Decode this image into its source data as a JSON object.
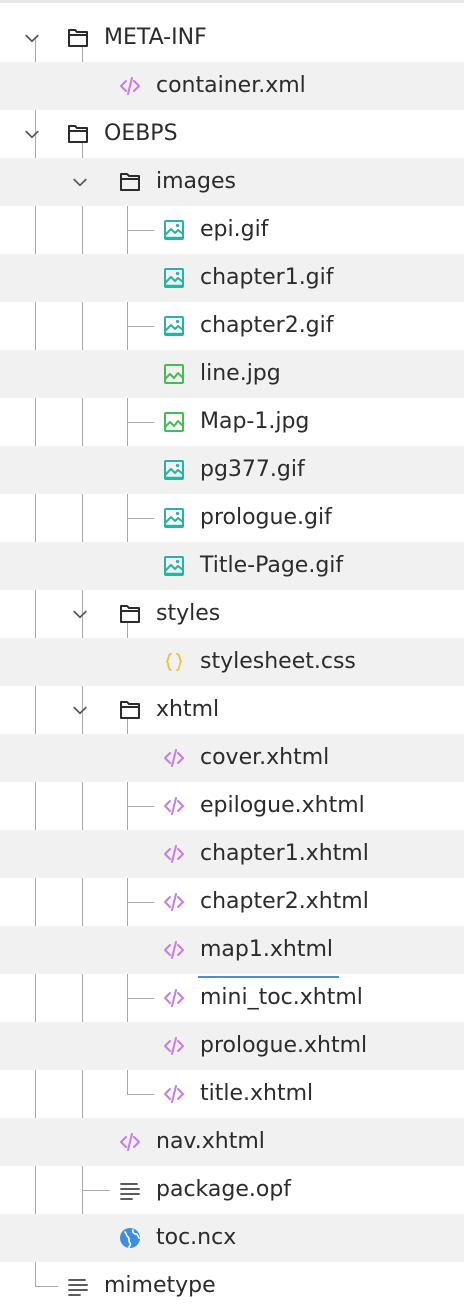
{
  "tree": {
    "nodes": [
      {
        "label": "META-INF",
        "type": "folder",
        "depth": 0,
        "expanded": true,
        "name": "folder-meta-inf"
      },
      {
        "label": "container.xml",
        "type": "xml",
        "depth": 1,
        "name": "file-container-xml"
      },
      {
        "label": "OEBPS",
        "type": "folder",
        "depth": 0,
        "expanded": true,
        "name": "folder-oebps"
      },
      {
        "label": "images",
        "type": "folder",
        "depth": 1,
        "expanded": true,
        "name": "folder-images"
      },
      {
        "label": "epi.gif",
        "type": "gif",
        "depth": 2,
        "name": "file-epi-gif"
      },
      {
        "label": "chapter1.gif",
        "type": "gif",
        "depth": 2,
        "name": "file-chapter1-gif"
      },
      {
        "label": "chapter2.gif",
        "type": "gif",
        "depth": 2,
        "name": "file-chapter2-gif"
      },
      {
        "label": "line.jpg",
        "type": "jpg",
        "depth": 2,
        "name": "file-line-jpg"
      },
      {
        "label": "Map-1.jpg",
        "type": "jpg",
        "depth": 2,
        "name": "file-map-1-jpg"
      },
      {
        "label": "pg377.gif",
        "type": "gif",
        "depth": 2,
        "name": "file-pg377-gif"
      },
      {
        "label": "prologue.gif",
        "type": "gif",
        "depth": 2,
        "name": "file-prologue-gif"
      },
      {
        "label": "Title-Page.gif",
        "type": "gif",
        "depth": 2,
        "name": "file-title-page-gif"
      },
      {
        "label": "styles",
        "type": "folder",
        "depth": 1,
        "expanded": true,
        "name": "folder-styles"
      },
      {
        "label": "stylesheet.css",
        "type": "css",
        "depth": 2,
        "name": "file-stylesheet-css"
      },
      {
        "label": "xhtml",
        "type": "folder",
        "depth": 1,
        "expanded": true,
        "name": "folder-xhtml"
      },
      {
        "label": "cover.xhtml",
        "type": "xml",
        "depth": 2,
        "name": "file-cover-xhtml"
      },
      {
        "label": "epilogue.xhtml",
        "type": "xml",
        "depth": 2,
        "name": "file-epilogue-xhtml"
      },
      {
        "label": "chapter1.xhtml",
        "type": "xml",
        "depth": 2,
        "name": "file-chapter1-xhtml"
      },
      {
        "label": "chapter2.xhtml",
        "type": "xml",
        "depth": 2,
        "name": "file-chapter2-xhtml"
      },
      {
        "label": "map1.xhtml",
        "type": "xml",
        "depth": 2,
        "selected": true,
        "name": "file-map1-xhtml"
      },
      {
        "label": "mini_toc.xhtml",
        "type": "xml",
        "depth": 2,
        "name": "file-mini-toc-xhtml"
      },
      {
        "label": "prologue.xhtml",
        "type": "xml",
        "depth": 2,
        "name": "file-prologue-xhtml"
      },
      {
        "label": "title.xhtml",
        "type": "xml",
        "depth": 2,
        "name": "file-title-xhtml"
      },
      {
        "label": "nav.xhtml",
        "type": "xml",
        "depth": 1,
        "name": "file-nav-xhtml"
      },
      {
        "label": "package.opf",
        "type": "text",
        "depth": 1,
        "name": "file-package-opf"
      },
      {
        "label": "toc.ncx",
        "type": "globe",
        "depth": 1,
        "name": "file-toc-ncx"
      },
      {
        "label": "mimetype",
        "type": "text",
        "depth": 0,
        "name": "file-mimetype"
      }
    ]
  },
  "colors": {
    "xml": "#c77be8",
    "gif": "#27b3a3",
    "jpg": "#3fbf4f",
    "css": "#f2c230",
    "globe": "#3d8fdc",
    "text": "#444444",
    "folder": "#2b2b2b",
    "guide": "#a9a9a9",
    "selection": "#4a8fd0"
  }
}
